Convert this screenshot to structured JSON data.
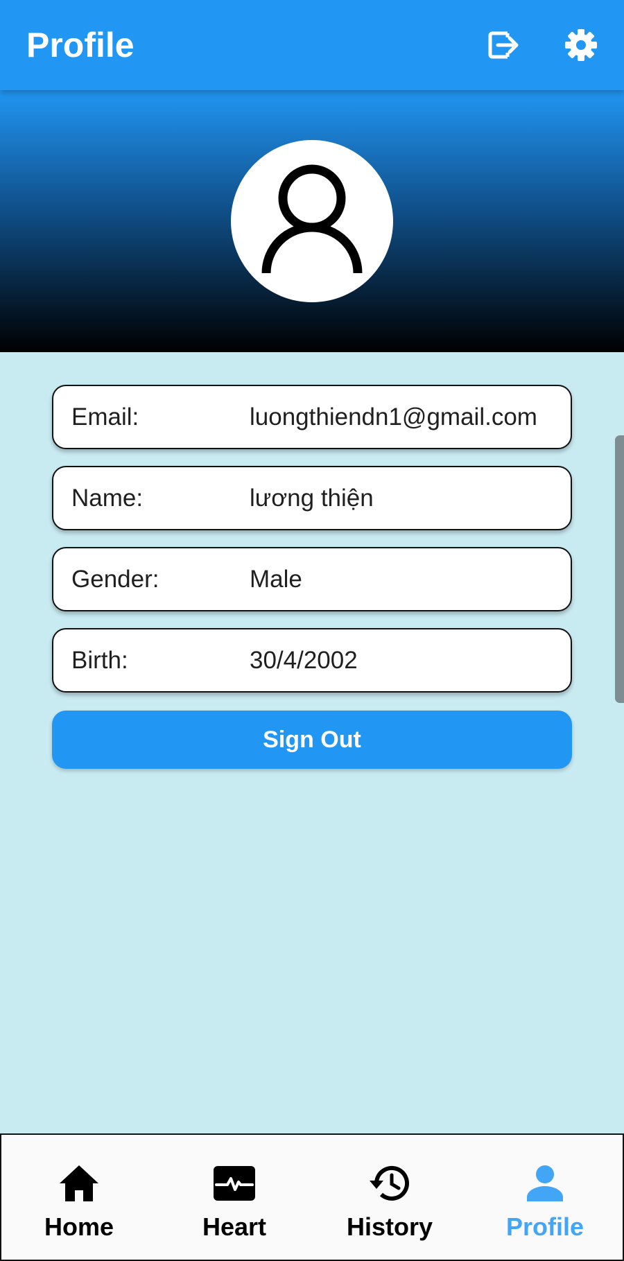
{
  "app_bar": {
    "title": "Profile",
    "actions": [
      {
        "icon": "logout-icon"
      },
      {
        "icon": "gear-icon"
      }
    ]
  },
  "profile": {
    "avatar_icon": "user-outline-icon",
    "fields": [
      {
        "label": "Email:",
        "value": "luongthiendn1@gmail.com"
      },
      {
        "label": "Name:",
        "value": "lương thiện"
      },
      {
        "label": "Gender:",
        "value": "Male"
      },
      {
        "label": "Birth:",
        "value": "30/4/2002"
      }
    ],
    "signout_label": "Sign Out"
  },
  "bottom_nav": {
    "items": [
      {
        "label": "Home",
        "icon": "home-icon"
      },
      {
        "label": "Heart",
        "icon": "heart-monitor-icon"
      },
      {
        "label": "History",
        "icon": "history-icon"
      },
      {
        "label": "Profile",
        "icon": "person-icon",
        "active": true
      }
    ]
  },
  "colors": {
    "primary": "#2196f3",
    "background": "#c8eaf1",
    "active_nav": "#42a5f5"
  }
}
